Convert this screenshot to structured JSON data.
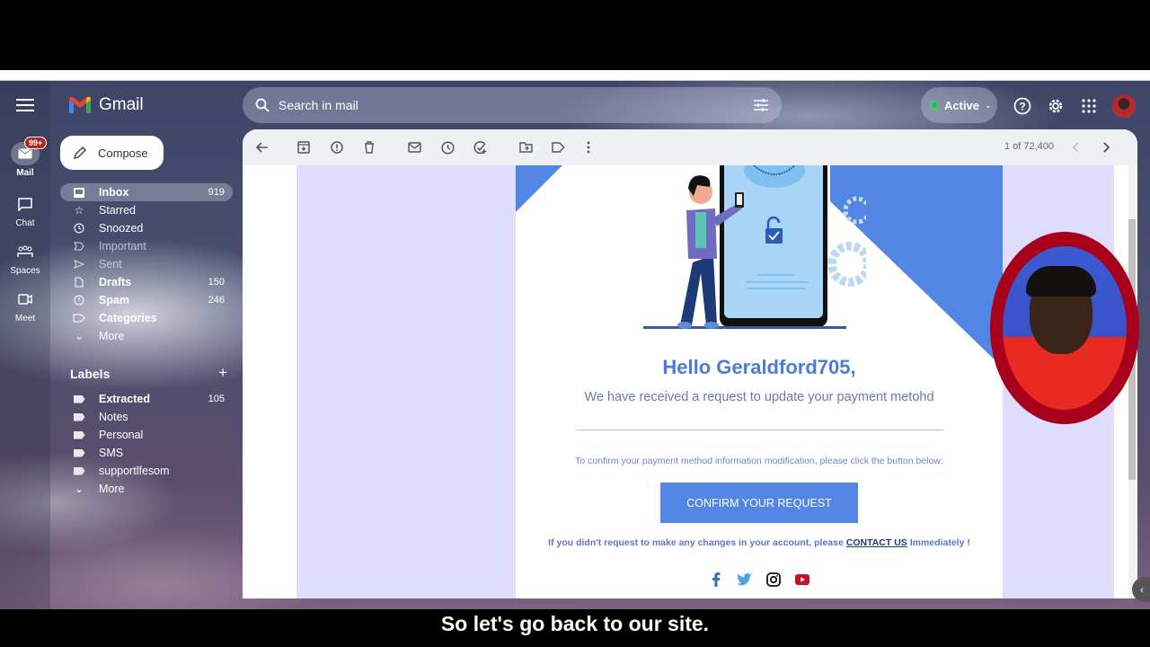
{
  "app": {
    "name": "Gmail"
  },
  "rail": {
    "items": [
      {
        "label": "Mail",
        "badge": "99+",
        "icon": "mail-icon"
      },
      {
        "label": "Chat",
        "icon": "chat-icon"
      },
      {
        "label": "Spaces",
        "icon": "spaces-icon"
      },
      {
        "label": "Meet",
        "icon": "video-icon"
      }
    ]
  },
  "compose": {
    "label": "Compose"
  },
  "nav": {
    "items": [
      {
        "label": "Inbox",
        "count": "919"
      },
      {
        "label": "Starred",
        "count": ""
      },
      {
        "label": "Snoozed",
        "count": ""
      },
      {
        "label": "Important",
        "count": ""
      },
      {
        "label": "Sent",
        "count": ""
      },
      {
        "label": "Drafts",
        "count": "150"
      },
      {
        "label": "Spam",
        "count": "246"
      },
      {
        "label": "Categories",
        "count": ""
      },
      {
        "label": "More",
        "count": ""
      }
    ]
  },
  "labels": {
    "title": "Labels",
    "items": [
      {
        "label": "Extracted",
        "count": "105"
      },
      {
        "label": "Notes",
        "count": ""
      },
      {
        "label": "Personal",
        "count": ""
      },
      {
        "label": "SMS",
        "count": ""
      },
      {
        "label": "supportlfesom",
        "count": ""
      },
      {
        "label": "More",
        "count": ""
      }
    ]
  },
  "search": {
    "placeholder": "Search in mail"
  },
  "status": {
    "label": "Active",
    "color": "#2bb558"
  },
  "toolbar": {
    "pager": "1 of 72,400"
  },
  "email": {
    "greeting": "Hello Geraldford705,",
    "subheading": "We have received a request to update your payment metohd",
    "instruction": "To confirm your payment method information modification, please click the button below:",
    "cta_label": "CONFIRM YOUR REQUEST",
    "warning_prefix": "If you didn't request to make any changes in your account, please",
    "warning_link": "CONTACT US",
    "warning_suffix": "Immediately !",
    "accent_color": "#5385e4",
    "social": [
      "facebook",
      "twitter",
      "instagram",
      "youtube"
    ]
  },
  "subtitle": {
    "text": "So let's go back to our site."
  }
}
